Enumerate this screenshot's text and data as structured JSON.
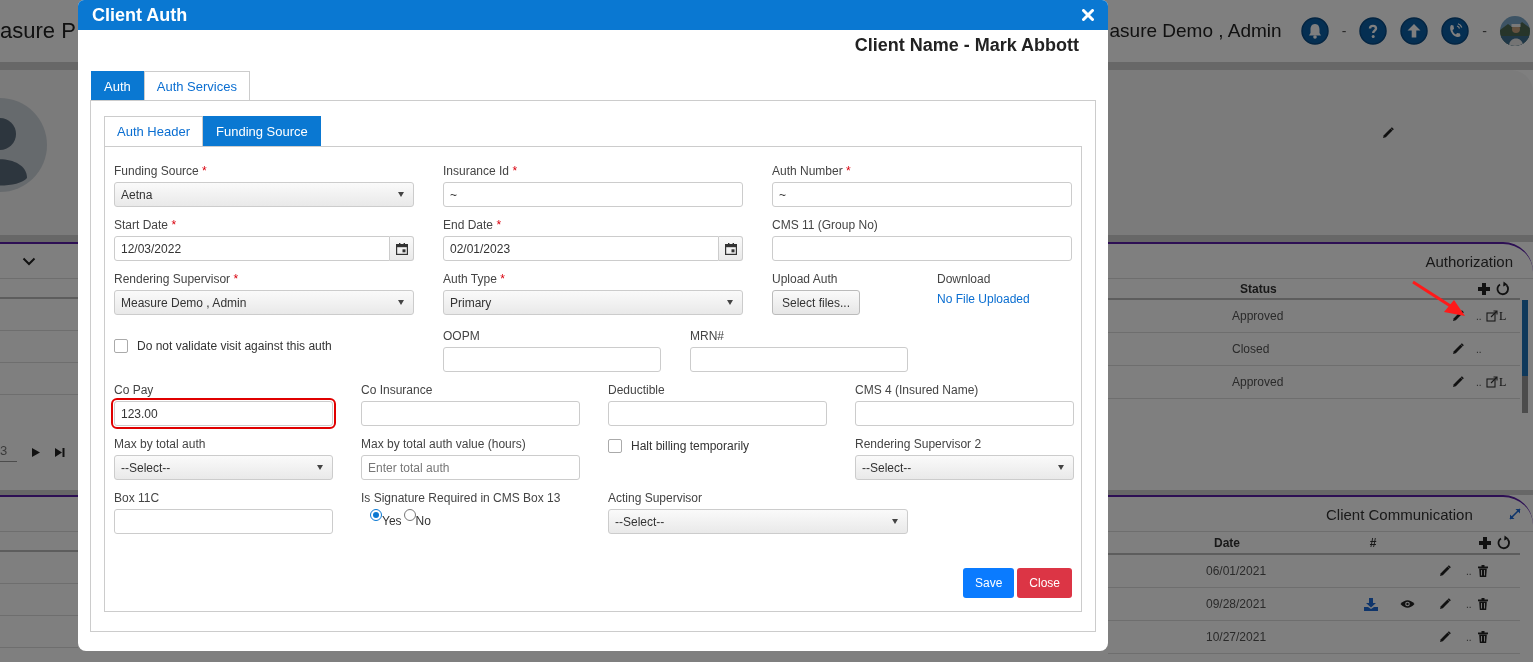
{
  "app_header": {
    "title": "asure P",
    "user_name": "asure Demo , Admin",
    "separators": [
      "-",
      "-"
    ]
  },
  "authorization_panel": {
    "title": "Authorization",
    "columns": [
      "Status"
    ],
    "rows": [
      {
        "status": "Approved",
        "separator": "..",
        "link_label": "L"
      },
      {
        "status": "Closed",
        "separator": ".."
      },
      {
        "status": "Approved",
        "separator": "..",
        "link_label": "L"
      }
    ],
    "pager": {
      "page": "3"
    }
  },
  "communication_panel": {
    "title": "Client Communication",
    "columns": [
      "Date",
      "#"
    ],
    "rows": [
      {
        "date": "06/01/2021",
        "has_attachment": false,
        "separator": ".."
      },
      {
        "date": "09/28/2021",
        "has_attachment": true,
        "separator": ".."
      },
      {
        "date": "10/27/2021",
        "has_attachment": false,
        "separator": ".."
      }
    ]
  },
  "dialog": {
    "title": "Client Auth",
    "client_name": "Client Name - Mark Abbott",
    "tabs": [
      {
        "label": "Auth",
        "selected": true
      },
      {
        "label": "Auth Services",
        "selected": false
      }
    ],
    "sub_tabs": [
      {
        "label": "Auth Header",
        "selected": false
      },
      {
        "label": "Funding Source",
        "selected": true
      }
    ],
    "form_rows": [
      {
        "fields": [
          {
            "kind": "select",
            "label": "Funding Source",
            "required_mark": "*",
            "value": "Aetna"
          },
          {
            "kind": "input",
            "label": "Insurance Id",
            "required_mark": "*",
            "value": "~"
          },
          {
            "kind": "input",
            "label": "Auth Number",
            "required_mark": "*",
            "value": "~"
          }
        ]
      },
      {
        "fields": [
          {
            "kind": "date",
            "label": "Start Date",
            "required_mark": "*",
            "value": "12/03/2022"
          },
          {
            "kind": "date",
            "label": "End Date",
            "required_mark": "*",
            "value": "02/01/2023"
          },
          {
            "kind": "input",
            "label": "CMS 11 (Group No)"
          }
        ]
      },
      {
        "fields": [
          {
            "kind": "select",
            "label": "Rendering Supervisor",
            "required_mark": "*",
            "value": "Measure Demo , Admin"
          },
          {
            "kind": "select",
            "label": "Auth Type",
            "required_mark": "*",
            "value": "Primary"
          },
          {
            "kind": "upload",
            "label": "Upload Auth",
            "button": "Select files..."
          },
          {
            "kind": "download",
            "label": "Download",
            "link": "No File Uploaded"
          }
        ]
      },
      {
        "fields": [
          {
            "kind": "checkbox",
            "label": "Do not validate visit against this auth",
            "checked": false
          },
          {
            "kind": "input",
            "label": "OOPM"
          },
          {
            "kind": "input",
            "label": "MRN#"
          }
        ]
      },
      {
        "fields": [
          {
            "kind": "input",
            "label": "Co Pay",
            "value": "123.00",
            "highlighted": true
          },
          {
            "kind": "input",
            "label": "Co Insurance"
          },
          {
            "kind": "input",
            "label": "Deductible"
          },
          {
            "kind": "input",
            "label": "CMS 4 (Insured Name)"
          }
        ]
      },
      {
        "fields": [
          {
            "kind": "select",
            "label": "Max by total auth",
            "value": "--Select--"
          },
          {
            "kind": "input",
            "label": "Max by total auth value (hours)",
            "placeholder": "Enter total auth"
          },
          {
            "kind": "checkbox",
            "label": "Halt billing temporarily",
            "checked": false
          },
          {
            "kind": "select",
            "label": "Rendering Supervisor 2",
            "value": "--Select--"
          }
        ]
      },
      {
        "fields": [
          {
            "kind": "input",
            "label": "Box 11C"
          },
          {
            "kind": "radio",
            "label": "Is Signature Required in CMS Box 13",
            "options": [
              {
                "label": "Yes",
                "selected": true
              },
              {
                "label": "No",
                "selected": false
              }
            ]
          },
          {
            "kind": "select",
            "label": "Acting Supervisor",
            "value": "--Select--"
          }
        ]
      }
    ],
    "buttons": [
      {
        "label": "Save",
        "kind": "primary"
      },
      {
        "label": "Close",
        "kind": "danger"
      }
    ]
  }
}
